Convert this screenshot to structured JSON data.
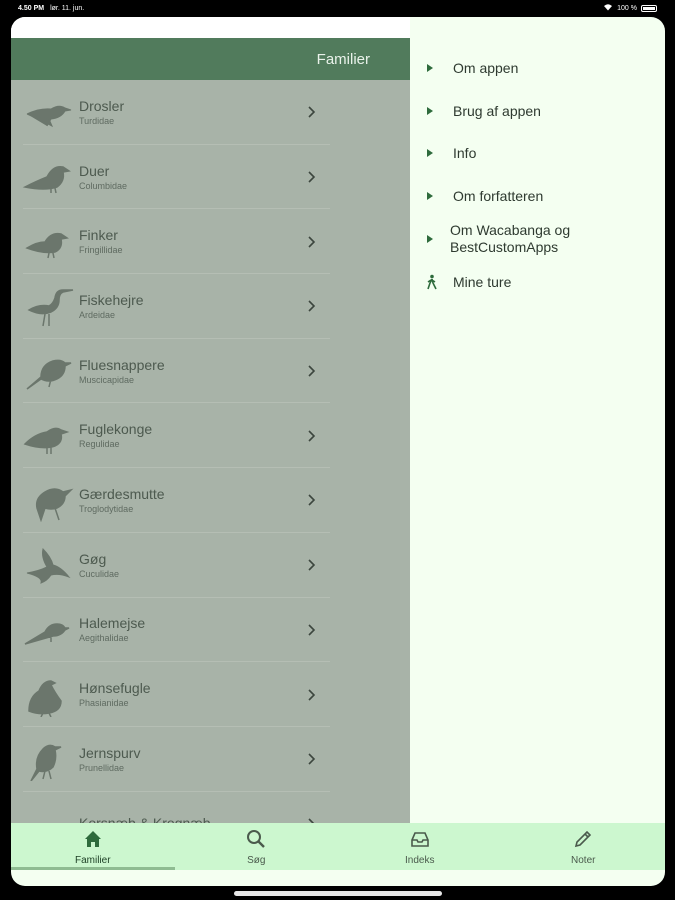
{
  "status": {
    "time": "4.50 PM",
    "date": "lør. 11. jun.",
    "battery": "100 %"
  },
  "header": {
    "title": "Familier"
  },
  "families": [
    {
      "name": "Drosler",
      "latin": "Turdidae",
      "icon": "thrush-icon"
    },
    {
      "name": "Duer",
      "latin": "Columbidae",
      "icon": "pigeon-icon"
    },
    {
      "name": "Finker",
      "latin": "Fringillidae",
      "icon": "finch-icon"
    },
    {
      "name": "Fiskehejre",
      "latin": "Ardeidae",
      "icon": "heron-icon"
    },
    {
      "name": "Fluesnappere",
      "latin": "Muscicapidae",
      "icon": "flycatcher-icon"
    },
    {
      "name": "Fuglekonge",
      "latin": "Regulidae",
      "icon": "goldcrest-icon"
    },
    {
      "name": "Gærdesmutte",
      "latin": "Troglodytidae",
      "icon": "wren-icon"
    },
    {
      "name": "Gøg",
      "latin": "Cuculidae",
      "icon": "cuckoo-icon"
    },
    {
      "name": "Halemejse",
      "latin": "Aegithalidae",
      "icon": "tit-icon"
    },
    {
      "name": "Hønsefugle",
      "latin": "Phasianidae",
      "icon": "gamebird-icon"
    },
    {
      "name": "Jernspurv",
      "latin": "Prunellidae",
      "icon": "dunnock-icon"
    },
    {
      "name": "Korsnæb & Krognæb",
      "latin": "",
      "icon": "crossbill-icon"
    }
  ],
  "menu": [
    {
      "label": "Om appen",
      "icon": "triangle-right-icon"
    },
    {
      "label": "Brug af appen",
      "icon": "triangle-right-icon"
    },
    {
      "label": "Info",
      "icon": "triangle-right-icon"
    },
    {
      "label": "Om forfatteren",
      "icon": "triangle-right-icon"
    },
    {
      "label": "Om Wacabanga og BestCustomApps",
      "icon": "triangle-right-icon"
    },
    {
      "label": "Mine ture",
      "icon": "hiker-icon"
    }
  ],
  "tabs": [
    {
      "label": "Familier",
      "icon": "home-icon",
      "active": true
    },
    {
      "label": "Søg",
      "icon": "search-icon",
      "active": false
    },
    {
      "label": "Indeks",
      "icon": "inbox-icon",
      "active": false
    },
    {
      "label": "Noter",
      "icon": "pencil-icon",
      "active": false
    }
  ],
  "colors": {
    "header": "#517b5c",
    "list_bg": "#a8b3a8",
    "menu_bg": "#f4fff1",
    "tabbar": "#ccf7cf",
    "accent": "#2e6b3c"
  }
}
